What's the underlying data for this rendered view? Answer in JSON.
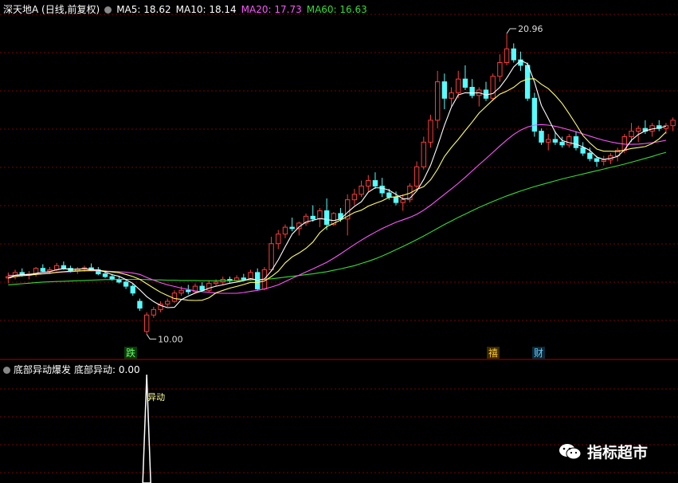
{
  "header": {
    "title": "深天地A (日线,前复权)",
    "ma5": "MA5: 18.62",
    "ma10": "MA10: 18.14",
    "ma20": "MA20: 17.73",
    "ma60": "MA60: 16.63"
  },
  "indicator": {
    "name": "底部异动爆发",
    "value": "底部异动: 0.00",
    "signal_label": "异动"
  },
  "annotations": {
    "high_label": "20.96",
    "low_label": "10.00",
    "tag_die": "跌",
    "tag_zhang": "禧",
    "tag_cai": "财"
  },
  "watermark": "指标超市",
  "colors": {
    "up": "#ff3b3b",
    "down": "#54ffff",
    "ma5": "#ffffff",
    "ma10": "#ffff66",
    "ma20": "#ff55ff",
    "ma60": "#33dd33",
    "grid": "#7a0000"
  },
  "chart_data": {
    "type": "candlestick",
    "y_range": [
      9.4,
      21.6
    ],
    "candles": [
      [
        12.05,
        12.25,
        11.85,
        12.1
      ],
      [
        12.1,
        12.35,
        12.0,
        12.25
      ],
      [
        12.25,
        12.4,
        12.1,
        12.15
      ],
      [
        12.15,
        12.3,
        12.0,
        12.2
      ],
      [
        12.2,
        12.45,
        12.1,
        12.4
      ],
      [
        12.4,
        12.55,
        12.25,
        12.3
      ],
      [
        12.3,
        12.45,
        12.2,
        12.35
      ],
      [
        12.35,
        12.6,
        12.3,
        12.5
      ],
      [
        12.5,
        12.65,
        12.35,
        12.4
      ],
      [
        12.4,
        12.5,
        12.25,
        12.3
      ],
      [
        12.3,
        12.45,
        12.2,
        12.38
      ],
      [
        12.38,
        12.5,
        12.28,
        12.42
      ],
      [
        12.42,
        12.58,
        12.3,
        12.35
      ],
      [
        12.35,
        12.45,
        12.15,
        12.2
      ],
      [
        12.2,
        12.3,
        12.05,
        12.1
      ],
      [
        12.1,
        12.2,
        11.95,
        12.0
      ],
      [
        12.0,
        12.1,
        11.85,
        11.9
      ],
      [
        11.9,
        12.0,
        11.65,
        11.75
      ],
      [
        11.75,
        11.85,
        11.4,
        11.5
      ],
      [
        11.2,
        11.3,
        10.85,
        10.95
      ],
      [
        10.1,
        10.8,
        10.0,
        10.7
      ],
      [
        10.7,
        11.0,
        10.6,
        10.9
      ],
      [
        10.9,
        11.2,
        10.8,
        11.1
      ],
      [
        11.1,
        11.3,
        11.0,
        11.2
      ],
      [
        11.2,
        11.6,
        11.15,
        11.5
      ],
      [
        11.5,
        11.75,
        11.4,
        11.6
      ],
      [
        11.6,
        11.8,
        11.45,
        11.55
      ],
      [
        11.55,
        11.85,
        11.5,
        11.75
      ],
      [
        11.75,
        11.9,
        11.55,
        11.6
      ],
      [
        11.6,
        11.95,
        11.55,
        11.85
      ],
      [
        11.85,
        12.0,
        11.75,
        11.9
      ],
      [
        11.9,
        12.1,
        11.8,
        12.0
      ],
      [
        12.0,
        12.1,
        11.85,
        11.95
      ],
      [
        11.95,
        12.15,
        11.9,
        12.05
      ],
      [
        12.05,
        12.2,
        11.95,
        12.0
      ],
      [
        12.0,
        12.35,
        11.95,
        12.25
      ],
      [
        12.25,
        12.4,
        11.6,
        11.65
      ],
      [
        11.65,
        12.45,
        11.6,
        12.35
      ],
      [
        12.35,
        13.55,
        12.3,
        13.3
      ],
      [
        13.3,
        13.8,
        13.1,
        13.65
      ],
      [
        13.65,
        14.0,
        13.5,
        13.9
      ],
      [
        13.9,
        14.25,
        13.75,
        13.85
      ],
      [
        13.85,
        14.1,
        13.6,
        14.05
      ],
      [
        14.05,
        14.4,
        13.95,
        14.3
      ],
      [
        14.3,
        14.7,
        14.1,
        14.2
      ],
      [
        14.2,
        14.6,
        13.9,
        14.5
      ],
      [
        14.5,
        14.95,
        13.8,
        14.0
      ],
      [
        14.0,
        14.45,
        13.95,
        14.4
      ],
      [
        14.4,
        14.6,
        14.1,
        14.2
      ],
      [
        14.2,
        15.1,
        13.6,
        14.9
      ],
      [
        14.9,
        15.3,
        14.7,
        15.1
      ],
      [
        15.1,
        15.6,
        15.0,
        15.4
      ],
      [
        15.4,
        15.8,
        15.2,
        15.6
      ],
      [
        15.6,
        15.9,
        15.3,
        15.4
      ],
      [
        15.4,
        15.7,
        15.0,
        15.15
      ],
      [
        15.15,
        15.3,
        14.9,
        15.0
      ],
      [
        15.0,
        15.2,
        14.7,
        14.8
      ],
      [
        14.8,
        15.1,
        14.5,
        14.9
      ],
      [
        14.9,
        15.5,
        14.8,
        15.4
      ],
      [
        15.4,
        16.3,
        15.3,
        16.1
      ],
      [
        16.1,
        17.2,
        16.0,
        17.0
      ],
      [
        17.0,
        18.0,
        16.8,
        17.8
      ],
      [
        17.8,
        19.6,
        17.5,
        19.2
      ],
      [
        19.2,
        19.5,
        18.2,
        18.6
      ],
      [
        18.6,
        19.0,
        18.3,
        18.8
      ],
      [
        18.8,
        19.6,
        18.6,
        19.3
      ],
      [
        19.3,
        19.8,
        18.9,
        19.0
      ],
      [
        19.0,
        19.3,
        18.6,
        18.7
      ],
      [
        18.7,
        19.0,
        18.3,
        18.9
      ],
      [
        18.9,
        19.2,
        18.5,
        18.6
      ],
      [
        18.6,
        19.5,
        18.5,
        19.4
      ],
      [
        19.4,
        20.2,
        19.2,
        19.9
      ],
      [
        19.9,
        20.96,
        19.8,
        20.4
      ],
      [
        20.4,
        20.6,
        19.9,
        20.0
      ],
      [
        20.0,
        20.3,
        19.6,
        19.8
      ],
      [
        19.8,
        19.9,
        18.5,
        18.6
      ],
      [
        18.6,
        18.8,
        17.2,
        17.4
      ],
      [
        17.4,
        17.5,
        16.9,
        17.0
      ],
      [
        17.0,
        17.3,
        16.7,
        17.1
      ],
      [
        17.1,
        17.4,
        16.9,
        17.0
      ],
      [
        17.0,
        17.2,
        16.8,
        16.9
      ],
      [
        16.9,
        17.3,
        16.8,
        17.2
      ],
      [
        17.2,
        17.4,
        16.7,
        16.8
      ],
      [
        16.8,
        17.0,
        16.5,
        16.6
      ],
      [
        16.6,
        16.8,
        16.3,
        16.4
      ],
      [
        16.4,
        16.5,
        16.1,
        16.3
      ],
      [
        16.3,
        16.5,
        16.15,
        16.35
      ],
      [
        16.35,
        16.6,
        16.2,
        16.5
      ],
      [
        16.5,
        16.8,
        16.3,
        16.7
      ],
      [
        16.7,
        17.3,
        16.6,
        17.2
      ],
      [
        17.2,
        17.7,
        17.0,
        17.4
      ],
      [
        17.4,
        17.6,
        17.0,
        17.5
      ],
      [
        17.5,
        17.8,
        17.3,
        17.4
      ],
      [
        17.4,
        17.7,
        17.2,
        17.6
      ],
      [
        17.6,
        17.8,
        17.4,
        17.5
      ],
      [
        17.5,
        17.7,
        17.3,
        17.6
      ],
      [
        17.6,
        17.9,
        17.4,
        17.8
      ]
    ],
    "ma5": [
      12.05,
      12.15,
      12.17,
      12.17,
      12.22,
      12.26,
      12.28,
      12.35,
      12.39,
      12.37,
      12.37,
      12.39,
      12.36,
      12.33,
      12.27,
      12.17,
      12.11,
      11.99,
      11.85,
      11.62,
      11.37,
      11.19,
      11.05,
      10.97,
      10.98,
      11.26,
      11.39,
      11.5,
      11.58,
      11.68,
      11.75,
      11.8,
      11.86,
      11.9,
      11.95,
      12.03,
      11.97,
      12.01,
      12.31,
      12.71,
      13.19,
      13.65,
      13.91,
      14.09,
      14.15,
      14.22,
      14.18,
      14.14,
      14.2,
      14.44,
      14.66,
      14.83,
      15.18,
      15.34,
      15.33,
      15.25,
      15.1,
      14.93,
      14.95,
      15.22,
      15.64,
      16.16,
      16.86,
      17.62,
      18.28,
      18.72,
      18.8,
      18.79,
      18.8,
      18.72,
      18.77,
      19.0,
      19.34,
      19.74,
      19.98,
      19.86,
      19.2,
      18.34,
      17.86,
      17.36,
      17.06,
      16.98,
      16.93,
      16.83,
      16.7,
      16.46,
      16.37,
      16.41,
      16.48,
      16.72,
      17.07,
      17.28,
      17.41,
      17.48,
      17.52,
      17.58
    ],
    "ma10": [
      12.05,
      12.1,
      12.13,
      12.15,
      12.18,
      12.2,
      12.22,
      12.26,
      12.28,
      12.3,
      12.31,
      12.32,
      12.33,
      12.33,
      12.3,
      12.27,
      12.24,
      12.18,
      12.1,
      12.0,
      11.84,
      11.68,
      11.53,
      11.41,
      11.3,
      11.27,
      11.24,
      11.23,
      11.24,
      11.33,
      11.51,
      11.6,
      11.68,
      11.74,
      11.81,
      11.89,
      11.89,
      11.94,
      12.1,
      12.3,
      12.6,
      12.82,
      12.96,
      13.13,
      13.36,
      13.7,
      13.92,
      14.04,
      14.16,
      14.3,
      14.44,
      14.52,
      14.67,
      14.77,
      14.86,
      14.99,
      15.01,
      15.06,
      15.14,
      15.28,
      15.38,
      15.63,
      16.01,
      16.48,
      16.81,
      17.1,
      17.42,
      17.73,
      18.06,
      18.3,
      18.54,
      18.75,
      18.86,
      19.0,
      19.2,
      19.3,
      19.31,
      19.11,
      18.95,
      18.7,
      18.41,
      18.04,
      17.65,
      17.24,
      16.97,
      16.75,
      16.67,
      16.67,
      16.66,
      16.71,
      16.77,
      16.8,
      16.84,
      16.95,
      17.12,
      17.37
    ],
    "ma20": [
      12.15,
      12.14,
      12.15,
      12.17,
      12.19,
      12.21,
      12.23,
      12.25,
      12.27,
      12.28,
      12.3,
      12.31,
      12.31,
      12.31,
      12.3,
      12.29,
      12.28,
      12.26,
      12.23,
      12.18,
      12.07,
      11.97,
      11.88,
      11.8,
      11.74,
      11.68,
      11.63,
      11.58,
      11.55,
      11.53,
      11.5,
      11.49,
      11.49,
      11.49,
      11.52,
      11.56,
      11.6,
      11.65,
      11.72,
      11.8,
      11.92,
      12.04,
      12.15,
      12.27,
      12.38,
      12.5,
      12.62,
      12.77,
      12.93,
      13.1,
      13.27,
      13.43,
      13.58,
      13.72,
      13.85,
      13.97,
      14.08,
      14.17,
      14.26,
      14.37,
      14.52,
      14.7,
      14.9,
      15.1,
      15.3,
      15.5,
      15.72,
      15.95,
      16.18,
      16.4,
      16.63,
      16.86,
      17.08,
      17.28,
      17.44,
      17.55,
      17.62,
      17.64,
      17.62,
      17.58,
      17.52,
      17.45,
      17.38,
      17.3,
      17.22,
      17.14,
      17.07,
      17.01,
      16.96,
      16.93,
      16.92,
      16.93,
      16.95,
      16.98,
      17.02,
      17.07
    ],
    "ma60": [
      11.8,
      11.82,
      11.84,
      11.86,
      11.88,
      11.9,
      11.91,
      11.92,
      11.93,
      11.94,
      11.95,
      11.96,
      11.97,
      11.98,
      11.99,
      11.99,
      12.0,
      12.0,
      12.0,
      12.0,
      11.99,
      11.98,
      11.98,
      11.97,
      11.97,
      11.96,
      11.96,
      11.96,
      11.95,
      11.95,
      11.95,
      11.95,
      11.95,
      11.96,
      11.97,
      11.98,
      11.99,
      12.0,
      12.02,
      12.05,
      12.08,
      12.11,
      12.14,
      12.17,
      12.2,
      12.24,
      12.28,
      12.33,
      12.38,
      12.44,
      12.5,
      12.58,
      12.66,
      12.75,
      12.85,
      12.96,
      13.08,
      13.2,
      13.32,
      13.45,
      13.58,
      13.72,
      13.86,
      14.0,
      14.13,
      14.26,
      14.38,
      14.5,
      14.62,
      14.73,
      14.84,
      14.94,
      15.04,
      15.13,
      15.22,
      15.3,
      15.38,
      15.45,
      15.52,
      15.59,
      15.66,
      15.72,
      15.78,
      15.84,
      15.9,
      15.96,
      16.02,
      16.08,
      16.14,
      16.2,
      16.27,
      16.34,
      16.41,
      16.48,
      16.56,
      16.63
    ],
    "indicator_series": {
      "name": "底部异动",
      "spike_index": 20
    }
  }
}
